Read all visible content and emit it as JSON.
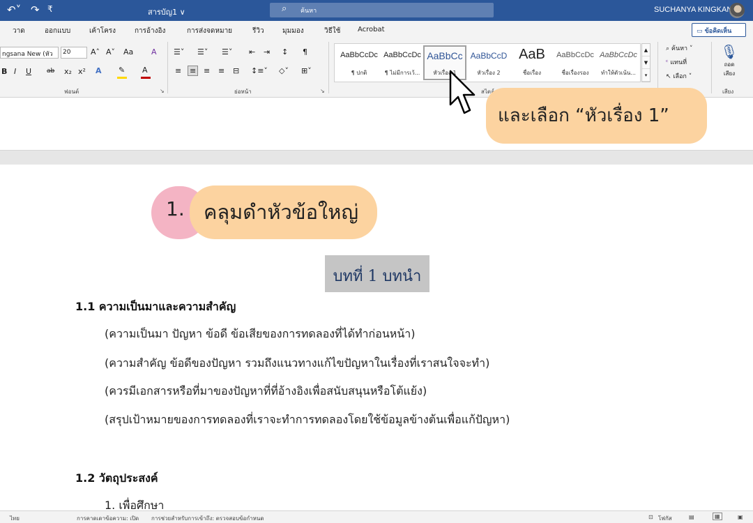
{
  "titlebar": {
    "undo_icon": "undo-icon",
    "redo_icon": "redo-icon",
    "qat_icon": "customize-qat-icon",
    "qat_glyph": "₹",
    "document_title": "สารบัญ1 ∨",
    "search_placeholder": "ค้นหา",
    "username": "SUCHANYA KINGKAN"
  },
  "menu": {
    "tabs": [
      "วาด",
      "ออกแบบ",
      "เค้าโครง",
      "การอ้างอิง",
      "การส่งจดหมาย",
      "รีวิว",
      "มุมมอง",
      "วิธีใช้",
      "Acrobat"
    ],
    "comments_label": "ข้อคิดเห็น"
  },
  "ribbon": {
    "font_name": "ngsana New (หัว",
    "font_size": "20",
    "grow_font": "A˄",
    "shrink_font": "A˅",
    "change_case": "Aa",
    "clear_format": "A",
    "bold": "B",
    "italic": "I",
    "underline": "U",
    "strikethrough": "ab",
    "subscript": "x₂",
    "superscript": "x²",
    "text_effects": "A",
    "font_color": "A",
    "font_group_label": "ฟอนต์",
    "paragraph_group_label": "ย่อหน้า",
    "styles_group_label": "สไตล์",
    "voice_group_label": "เสียง",
    "styles": [
      {
        "sample": "AaBbCcDc",
        "name": "¶ ปกติ"
      },
      {
        "sample": "AaBbCcDc",
        "name": "¶ ไม่มีการเว้..."
      },
      {
        "sample": "AaBbCc",
        "name": "หัวเรื่อง 1"
      },
      {
        "sample": "AaBbCcD",
        "name": "หัวเรื่อง 2"
      },
      {
        "sample": "AaB",
        "name": "ชื่อเรื่อง"
      },
      {
        "sample": "AaBbCcDc",
        "name": "ชื่อเรื่องรอง"
      },
      {
        "sample": "AaBbCcDc",
        "name": "ทำให้ตัวเน้น..."
      }
    ],
    "find_label": "ค้นหา",
    "replace_label": "แทนที่",
    "select_label": "เลือก",
    "dictate_label_1": "ถอด",
    "dictate_label_2": "เสียง",
    "colors": {
      "highlight": "#ffd800",
      "font": "#c00000",
      "accent": "#2b579a"
    }
  },
  "annotations": {
    "step_number": "1.",
    "step_text": "คลุมดำหัวข้อใหญ่",
    "callout": "และเลือก “หัวเรื่อง 1”"
  },
  "document": {
    "heading": "บทที่ 1 บทนำ",
    "section_1_title": "1.1 ความเป็นมาและความสำคัญ",
    "paragraphs": [
      "(ความเป็นมา ปัญหา ข้อดี ข้อเสียของการทดลองที่ได้ทำก่อนหน้า)",
      "(ความสำคัญ ข้อดีของปัญหา รวมถึงแนวทางแก้ไขปัญหาในเรื่องที่เราสนใจจะทำ)",
      "(ควรมีเอกสารหรือที่มาของปัญหาที่ที่อ้างอิงเพื่อสนับสนุนหรือโต้แย้ง)",
      "(สรุปเป้าหมายของการทดลองที่เราจะทำการทดลองโดยใช้ข้อมูลข้างต้นเพื่อแก้ปัญหา)"
    ],
    "section_2_title": "1.2 วัตถุประสงค์",
    "objective_1": "1. เพื่อศึกษา"
  },
  "statusbar": {
    "language": "ไทย",
    "text_predictions": "การคาดเดาข้อความ: เปิด",
    "accessibility": "การช่วยสำหรับการเข้าถึง: ตรวจสอบข้อกำหนด",
    "focus": "โฟกัส"
  }
}
